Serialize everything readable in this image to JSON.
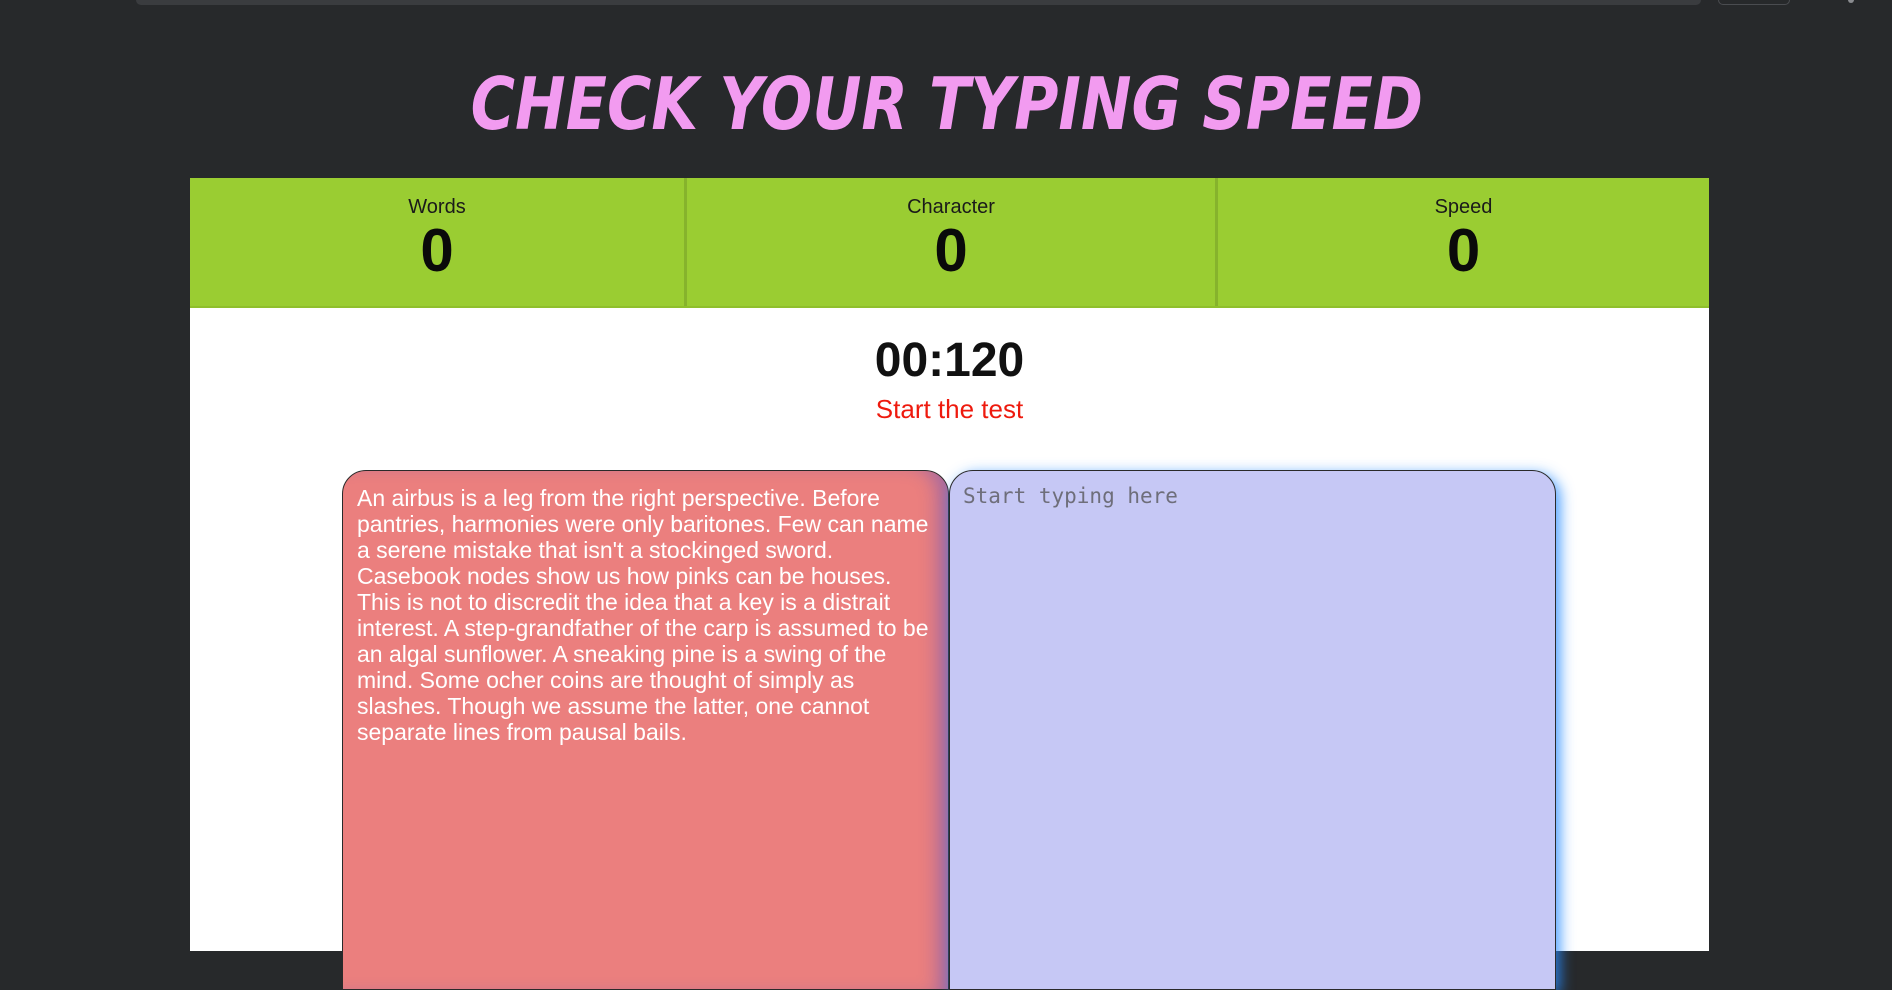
{
  "page": {
    "title": "CHECK YOUR TYPING SPEED"
  },
  "stats": {
    "words": {
      "label": "Words",
      "value": "0"
    },
    "characters": {
      "label": "Character",
      "value": "0"
    },
    "speed": {
      "label": "Speed",
      "value": "0"
    }
  },
  "timer": {
    "display": "00:120",
    "status": "Start the test"
  },
  "quote": {
    "text": "An airbus is a leg from the right perspective. Before pantries, harmonies were only baritones. Few can name a serene mistake that isn't a stockinged sword. Casebook nodes show us how pinks can be houses. This is not to discredit the idea that a key is a distrait interest. A step-grandfather of the carp is assumed to be an algal sunflower. A sneaking pine is a swing of the mind. Some ocher coins are thought of simply as slashes. Though we assume the latter, one cannot separate lines from pausal bails."
  },
  "input": {
    "placeholder": "Start typing here",
    "value": ""
  },
  "colors": {
    "background": "#27292b",
    "title": "#f29bf0",
    "stats_bar": "#9acd32",
    "status_text": "#ee1a0e",
    "quote_box": "#eb7f7e",
    "typing_box": "#c6c8f5",
    "typing_glow": "#288cff"
  }
}
